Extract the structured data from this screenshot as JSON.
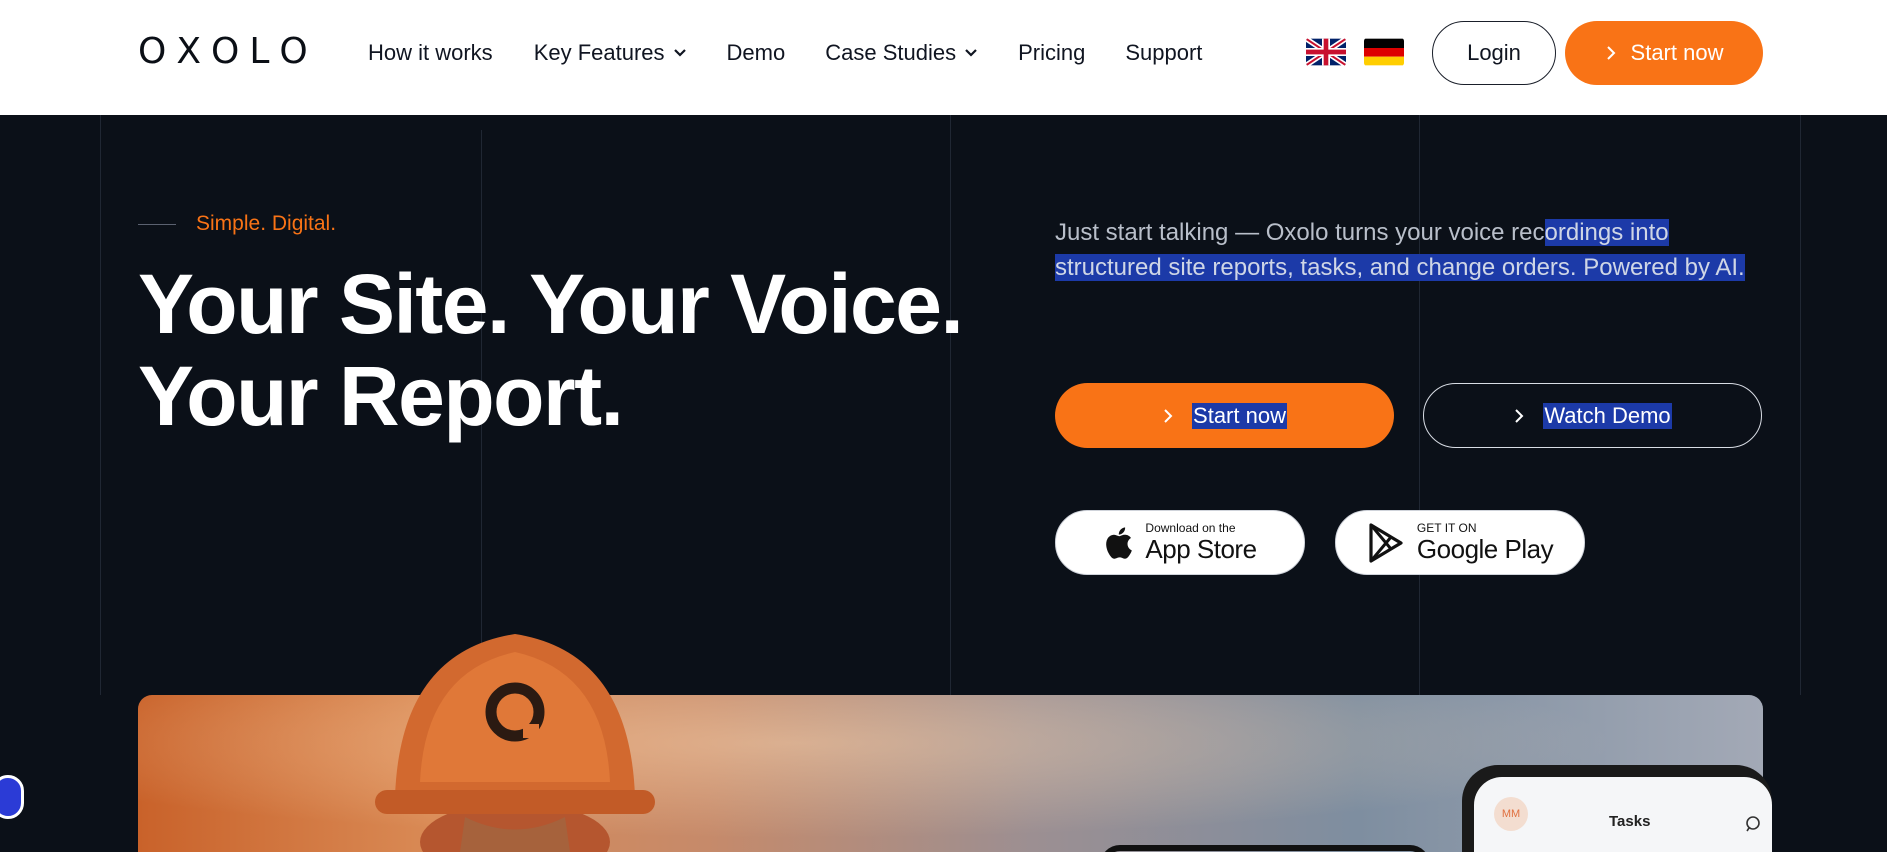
{
  "header": {
    "logo_letters": [
      "O",
      "X",
      "O",
      "L",
      "O"
    ],
    "nav": [
      {
        "label": "How it works",
        "dropdown": false
      },
      {
        "label": "Key Features",
        "dropdown": true
      },
      {
        "label": "Demo",
        "dropdown": false
      },
      {
        "label": "Case Studies",
        "dropdown": true
      },
      {
        "label": "Pricing",
        "dropdown": false
      },
      {
        "label": "Support",
        "dropdown": false
      }
    ],
    "flags": [
      "uk-flag-icon",
      "germany-flag-icon"
    ],
    "login_label": "Login",
    "start_label": "Start now"
  },
  "hero": {
    "tagline": "Simple. Digital.",
    "headline_line1": "Your Site. Your Voice.",
    "headline_line2": "Your Report.",
    "description_plain": "Just start talking — Oxolo turns your voice rec",
    "description_highlight": "ordings into structured site reports, tasks, and change orders. Powered by AI.",
    "cta_primary": "Start now",
    "cta_secondary": "Watch Demo",
    "app_store_small": "Download on the",
    "app_store_big": "App Store",
    "google_play_small": "GET IT ON",
    "google_play_big": "Google Play"
  },
  "phone": {
    "avatar_initials": "MM",
    "screen_title": "Tasks"
  },
  "colors": {
    "accent": "#f97316",
    "background": "#0b1018",
    "selection": "#1c3aa8"
  }
}
